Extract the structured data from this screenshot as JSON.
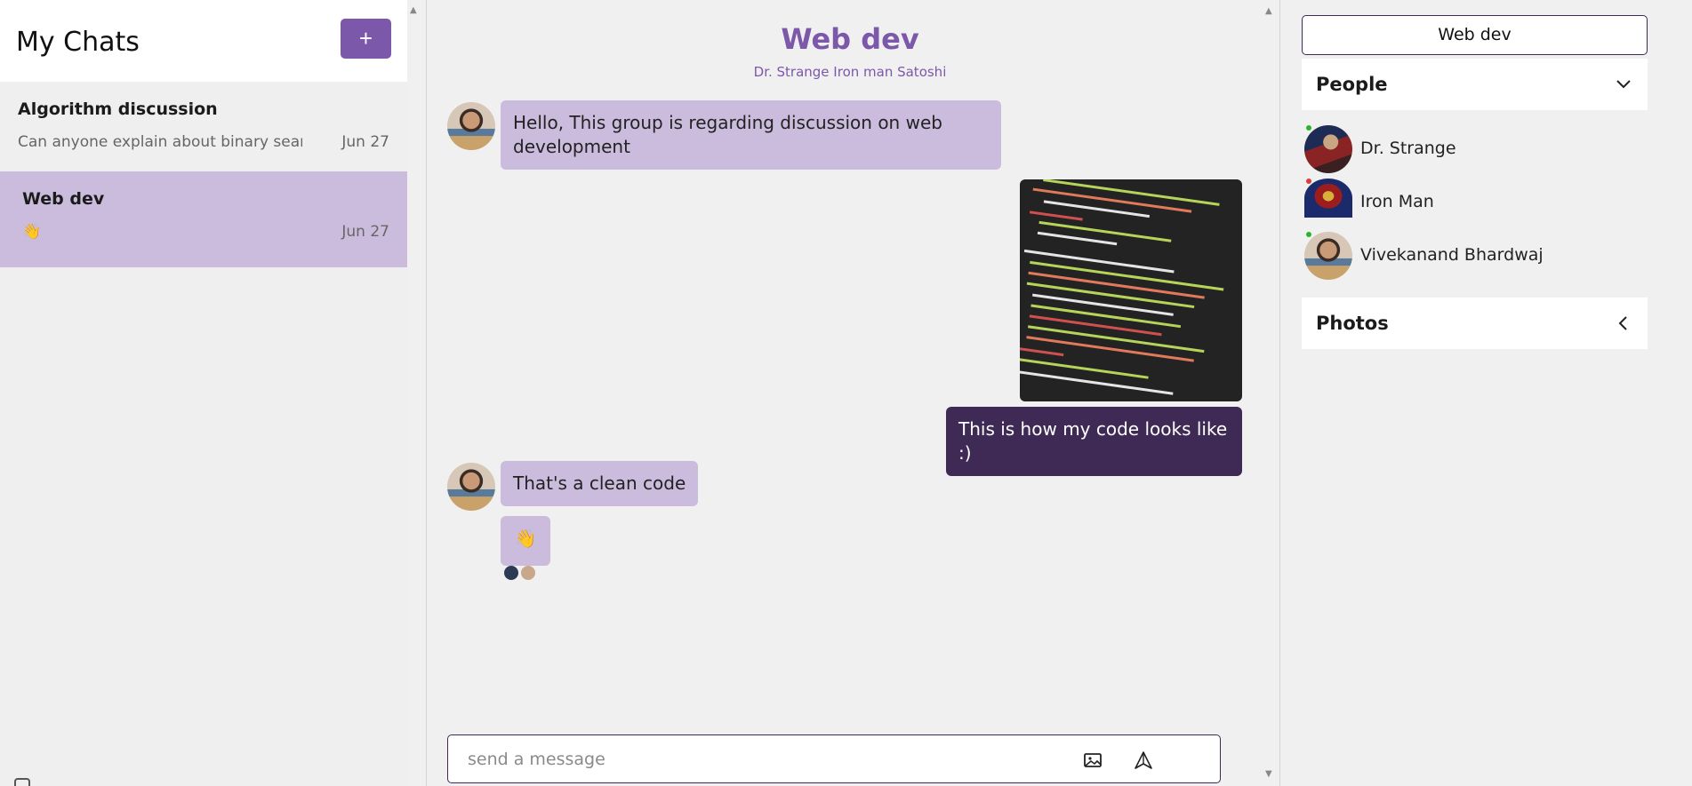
{
  "sidebar": {
    "title": "My Chats",
    "new_chat_label": "+",
    "chats": [
      {
        "name": "Algorithm discussion",
        "preview": "Can anyone explain about binary sear",
        "date": "Jun 27",
        "active": false
      },
      {
        "name": "Web dev",
        "preview": "👋",
        "date": "Jun 27",
        "active": true
      }
    ]
  },
  "chat": {
    "title": "Web dev",
    "members": "Dr. Strange Iron man Satoshi",
    "messages": [
      {
        "from": "Vivekanand Bhardwaj",
        "text": "Hello, This group is regarding discussion on web development",
        "mine": false
      },
      {
        "from": "me",
        "image": "code-screenshot",
        "mine": true
      },
      {
        "from": "me",
        "text": "This is how my code looks like :)",
        "mine": true
      },
      {
        "from": "Vivekanand Bhardwaj",
        "text": "That's a clean code",
        "mine": false
      },
      {
        "from": "Vivekanand Bhardwaj",
        "text": "👋",
        "mine": false
      }
    ],
    "composer": {
      "placeholder": "send a message",
      "value": ""
    }
  },
  "panel": {
    "group_name": "Web dev",
    "people_title": "People",
    "people": [
      {
        "name": "Dr. Strange",
        "status_color": "#2ab52a"
      },
      {
        "name": "Iron Man",
        "status_color": "#e03a3a"
      },
      {
        "name": "Vivekanand Bhardwaj",
        "status_color": "#2ab52a"
      }
    ],
    "photos_title": "Photos"
  },
  "colors": {
    "accent": "#7b58a9",
    "bubble_other": "#cbbcdd",
    "bubble_mine": "#3e2a55",
    "active_chat": "#cbbcdd"
  },
  "icons": {
    "add": "plus-icon",
    "image_upload": "image-icon",
    "send": "send-icon",
    "people_expand": "chevron-down-icon",
    "photos_expand": "chevron-left-icon"
  }
}
